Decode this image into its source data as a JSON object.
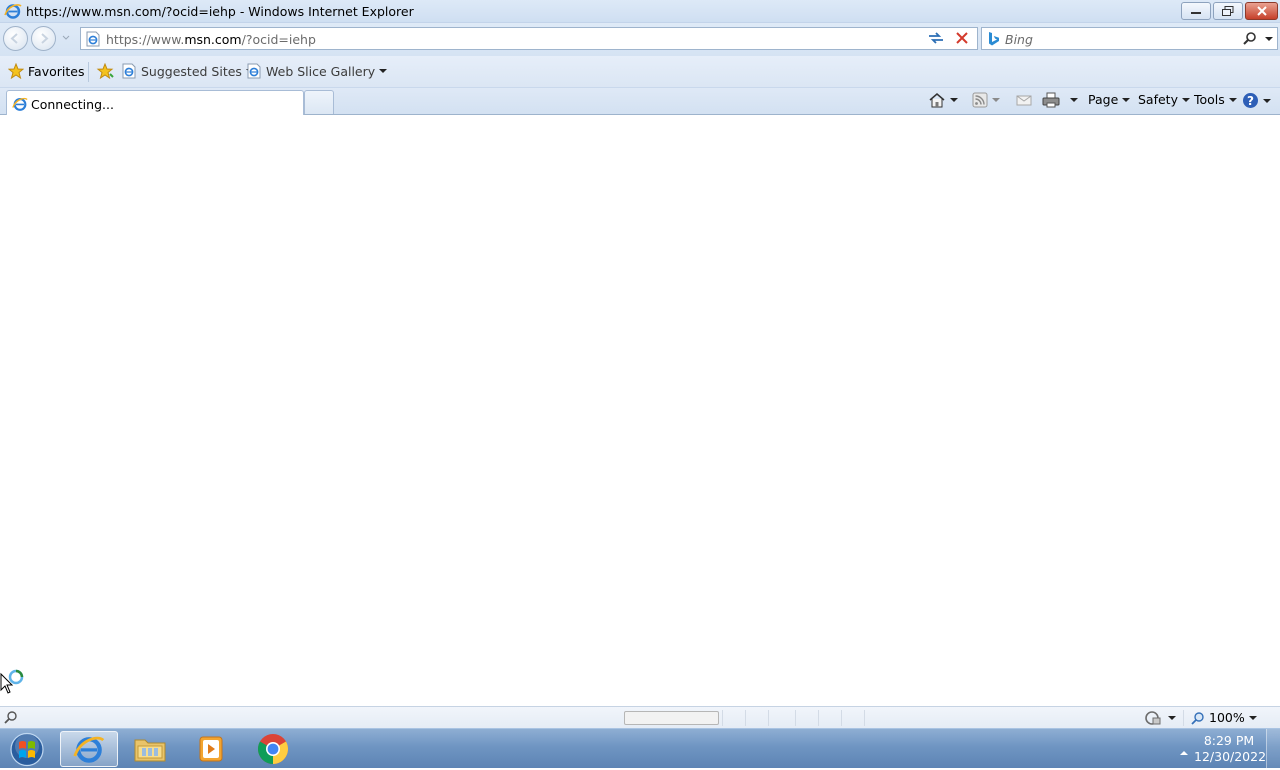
{
  "window": {
    "title": "https://www.msn.com/?ocid=iehp - Windows Internet Explorer"
  },
  "address": {
    "prefix": "https://www.",
    "domain": "msn.com",
    "suffix": "/?ocid=iehp"
  },
  "search": {
    "placeholder": "Bing"
  },
  "favorites_bar": {
    "favorites_label": "Favorites",
    "suggested_sites_label": "Suggested Sites",
    "web_slice_gallery_label": "Web Slice Gallery"
  },
  "tab": {
    "title": "Connecting..."
  },
  "command_bar": {
    "page_label": "Page",
    "safety_label": "Safety",
    "tools_label": "Tools"
  },
  "status_bar": {
    "status_text": "",
    "zoom": "100%",
    "progress_fraction": 0.0
  },
  "taskbar": {
    "time": "8:29 PM",
    "date": "12/30/2022"
  },
  "icons": {
    "browser": "internet-explorer-icon",
    "search_provider": "bing-icon",
    "favorites": "star-icon",
    "home": "home-icon",
    "feeds": "rss-icon",
    "mail": "mail-icon",
    "print": "printer-icon",
    "help": "help-icon"
  },
  "colors": {
    "chrome_blue": "#d5e3f3",
    "close_red": "#c6402a",
    "taskbar_blue": "#6f95c2"
  }
}
